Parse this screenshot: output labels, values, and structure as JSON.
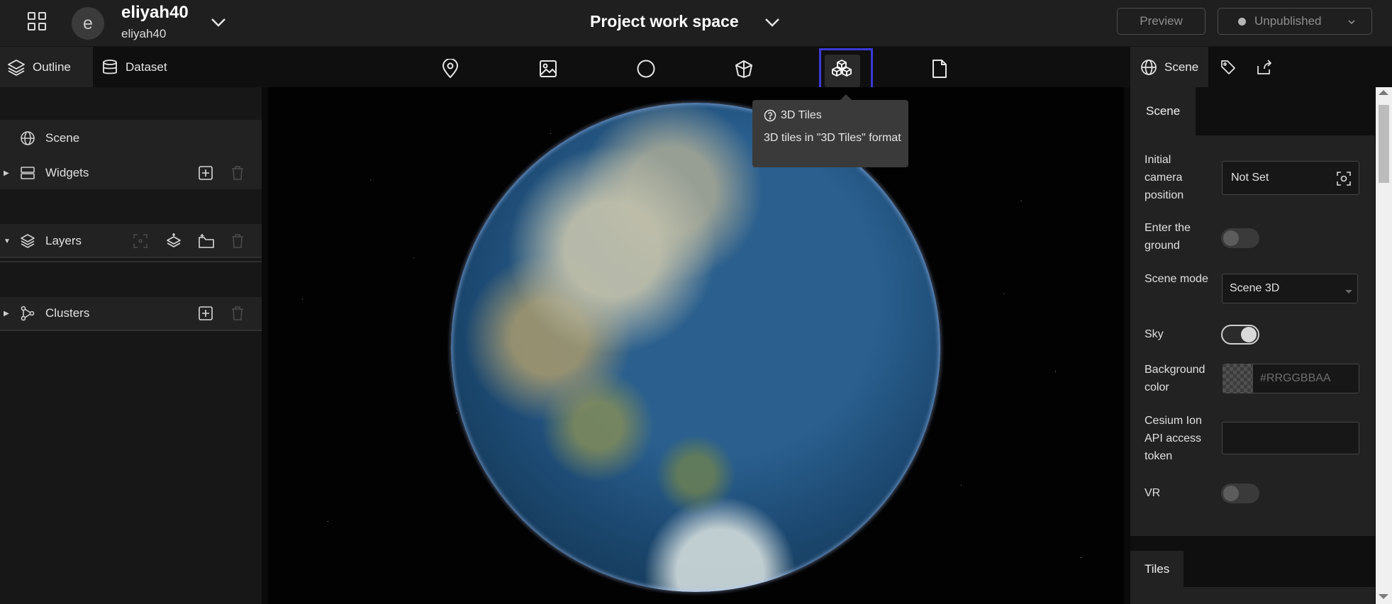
{
  "header": {
    "user_name": "eliyah40",
    "user_sub": "eliyah40",
    "avatar_letter": "e",
    "project_title": "Project work space",
    "preview_label": "Preview",
    "publish_label": "Unpublished"
  },
  "left_tabs": [
    {
      "label": "Outline",
      "icon": "layers-icon",
      "active": true
    },
    {
      "label": "Dataset",
      "icon": "database-icon",
      "active": false
    }
  ],
  "center_tools": [
    {
      "icon": "map-pin-icon"
    },
    {
      "icon": "image-icon"
    },
    {
      "icon": "circle-icon"
    },
    {
      "icon": "model-cube-icon"
    },
    {
      "icon": "3d-tiles-icon",
      "active": true
    },
    {
      "icon": "file-icon"
    }
  ],
  "tooltip": {
    "title": "3D Tiles",
    "description": "3D tiles in \"3D Tiles\" format"
  },
  "outline": {
    "scene_label": "Scene",
    "widgets_label": "Widgets",
    "layers_label": "Layers",
    "clusters_label": "Clusters"
  },
  "right_tabs": [
    {
      "label": "Scene",
      "icon": "globe-icon",
      "active": true
    },
    {
      "icon": "tag-icon"
    },
    {
      "icon": "export-icon"
    }
  ],
  "scene_panel": {
    "section_title": "Scene",
    "initial_camera_label": "Initial camera position",
    "initial_camera_value": "Not Set",
    "enter_ground_label": "Enter the ground",
    "enter_ground_on": false,
    "scene_mode_label": "Scene mode",
    "scene_mode_value": "Scene 3D",
    "sky_label": "Sky",
    "sky_on": true,
    "bg_color_label": "Background color",
    "bg_color_placeholder": "#RRGGBBAA",
    "cesium_token_label": "Cesium Ion API access token",
    "cesium_token_value": "",
    "vr_label": "VR",
    "vr_on": false,
    "tiles_section_title": "Tiles"
  },
  "colors": {
    "highlight": "#3a3ad8",
    "panel": "#171717",
    "header": "#1f1f1f"
  }
}
